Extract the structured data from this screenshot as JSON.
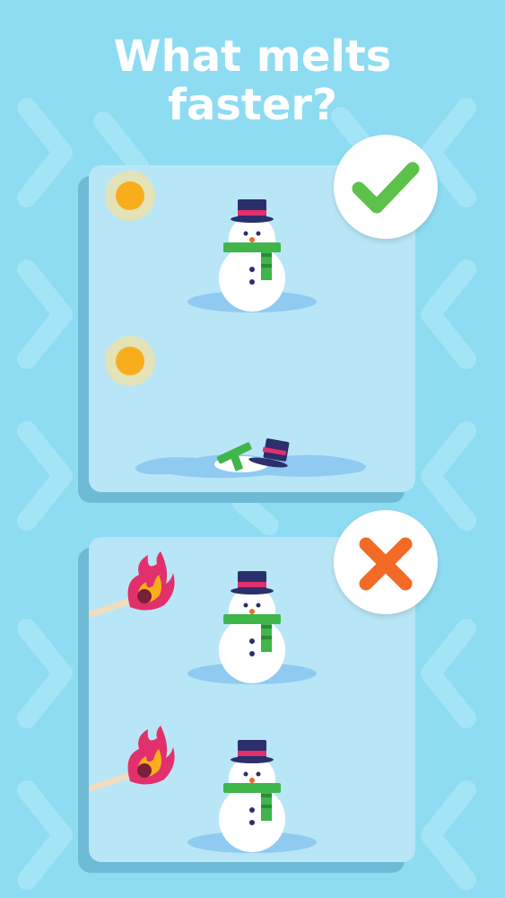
{
  "title_line1": "What melts",
  "title_line2": "faster?",
  "colors": {
    "background": "#8edcf2",
    "card": "#b9e6f7",
    "check": "#5cc24a",
    "cross": "#f26a25",
    "scarf": "#3fb54a",
    "hat": "#2b2f6b",
    "hat_band": "#e2306c"
  },
  "options": [
    {
      "condition_icon": "sun-icon",
      "answer": "correct",
      "answer_icon": "checkmark-icon"
    },
    {
      "condition_icon": "burning-match-icon",
      "answer": "incorrect",
      "answer_icon": "cross-icon"
    }
  ]
}
